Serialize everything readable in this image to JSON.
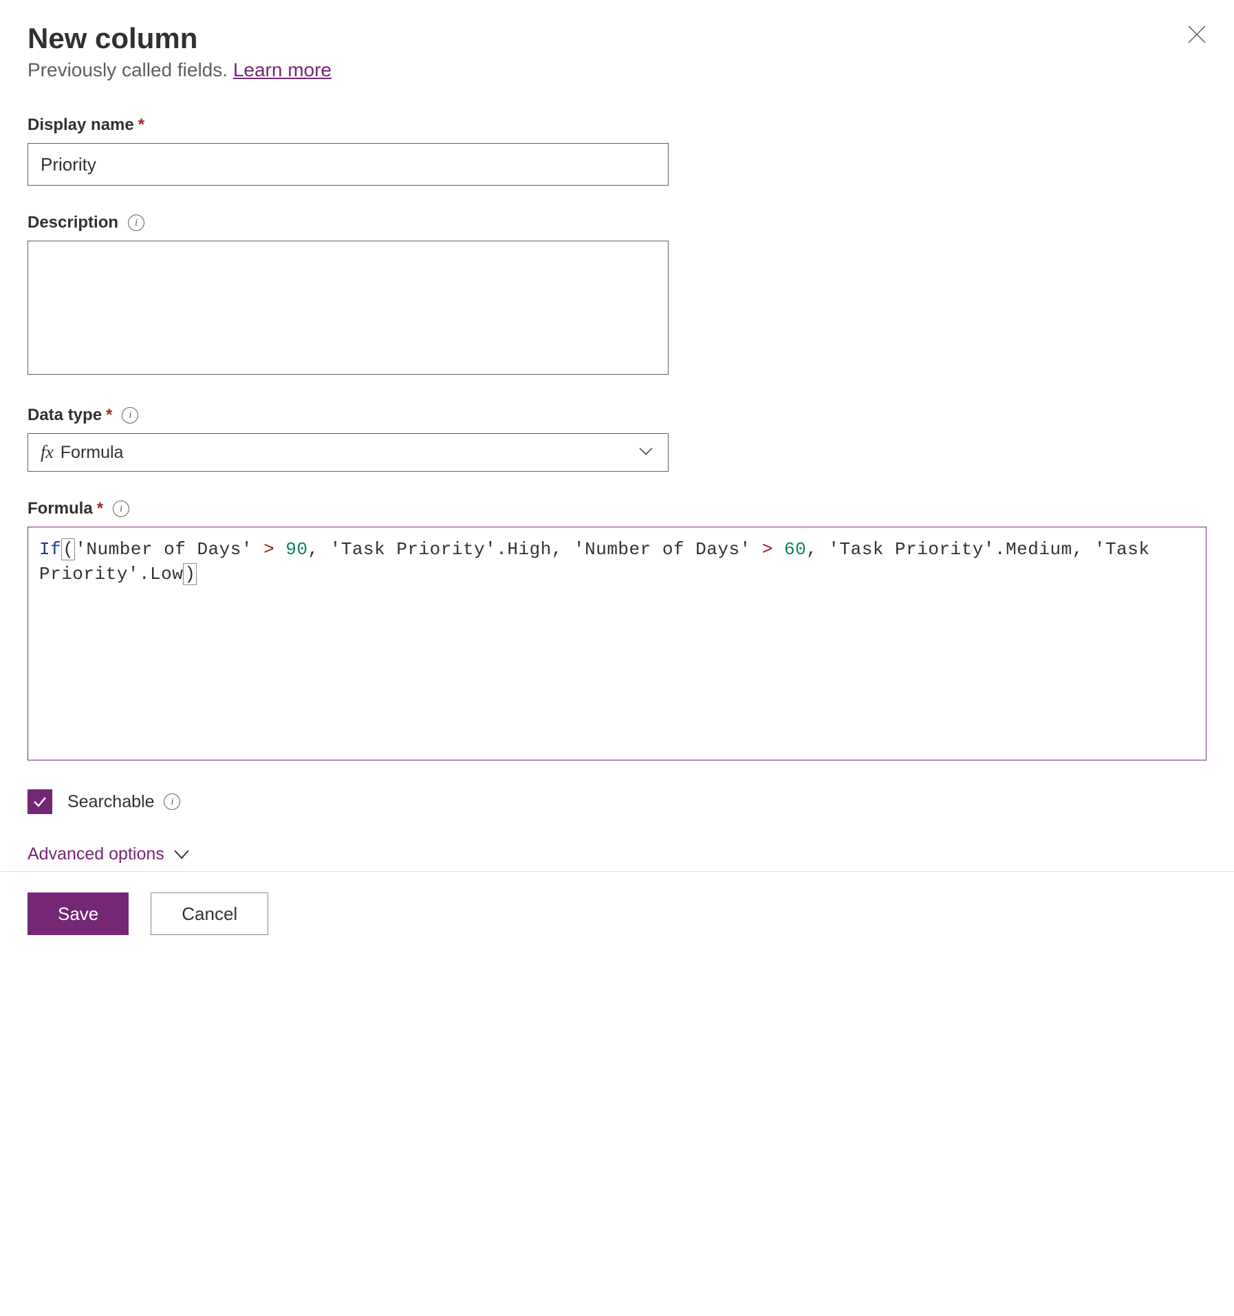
{
  "header": {
    "title": "New column",
    "subtitle_prefix": "Previously called fields. ",
    "learn_more": "Learn more"
  },
  "fields": {
    "display_name": {
      "label": "Display name",
      "value": "Priority"
    },
    "description": {
      "label": "Description",
      "value": ""
    },
    "data_type": {
      "label": "Data type",
      "selected": "Formula"
    },
    "formula": {
      "label": "Formula",
      "tokens": {
        "if": "If",
        "open": "(",
        "close": ")",
        "str1": "'Number of Days'",
        "gt": ">",
        "num90": "90",
        "comma": ",",
        "str2": "'Task Priority'",
        "dot_high": ".High",
        "num60": "60",
        "dot_medium": ".Medium",
        "dot_low": ".Low"
      },
      "raw": "If('Number of Days' > 90, 'Task Priority'.High, 'Number of Days' > 60, 'Task Priority'.Medium, 'Task Priority'.Low)"
    },
    "searchable": {
      "label": "Searchable",
      "checked": true
    }
  },
  "advanced": {
    "label": "Advanced options"
  },
  "footer": {
    "save": "Save",
    "cancel": "Cancel"
  }
}
